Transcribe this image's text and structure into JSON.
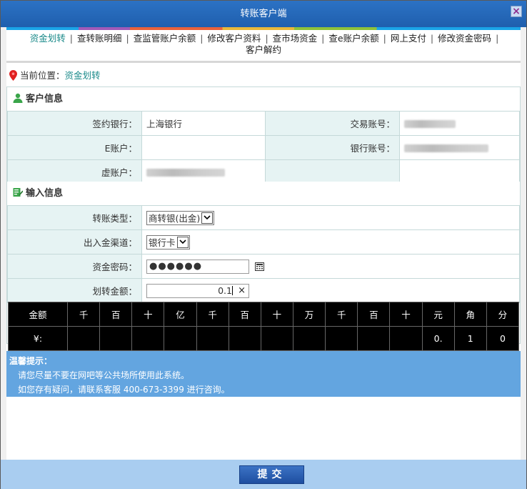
{
  "window": {
    "title": "转账客户端",
    "close_label": "×"
  },
  "tabs": [
    {
      "label": "资金划转",
      "active": true
    },
    {
      "label": "查转账明细"
    },
    {
      "label": "查监管账户余额"
    },
    {
      "label": "修改客户资料"
    },
    {
      "label": "查市场资金"
    },
    {
      "label": "查e账户余额"
    },
    {
      "label": "网上支付"
    },
    {
      "label": "修改资金密码"
    },
    {
      "label": "客户解约"
    }
  ],
  "tab_separator": "|",
  "breadcrumb": {
    "label": "当前位置：",
    "current": "资金划转"
  },
  "customer_info": {
    "title": "客户信息",
    "bank_label": "签约银行：",
    "bank_value": "上海银行",
    "trade_account_label": "交易账号：",
    "e_account_label": "E账户：",
    "bank_account_label": "银行账号：",
    "virtual_account_label": "虚账户："
  },
  "input_info": {
    "title": "输入信息",
    "transfer_type_label": "转账类型：",
    "transfer_type_value": "商转银(出金)",
    "channel_label": "出入金渠道：",
    "channel_value": "银行卡",
    "password_label": "资金密码：",
    "password_value": "●●●●●●",
    "amount_label": "划转金额：",
    "amount_value": "0.1",
    "clear_label": "×"
  },
  "digit_table": {
    "headers": [
      "金额",
      "千",
      "百",
      "十",
      "亿",
      "千",
      "百",
      "十",
      "万",
      "千",
      "百",
      "十",
      "元",
      "角",
      "分"
    ],
    "values": [
      "¥:",
      "",
      "",
      "",
      "",
      "",
      "",
      "",
      "",
      "",
      "",
      "",
      "0.",
      "1",
      "0"
    ]
  },
  "notice": {
    "title": "温馨提示：",
    "line1": "请您尽量不要在网吧等公共场所使用此系统。",
    "line2": "如您存有疑问，请联系客服 400-673-3399 进行咨询。"
  },
  "submit_label": "提交",
  "colors": {
    "title_bar": "#1f5fae",
    "notice_bg": "#63a5e0",
    "label_bg": "#e6f3f3",
    "active_tab": "#1a8a8a"
  }
}
